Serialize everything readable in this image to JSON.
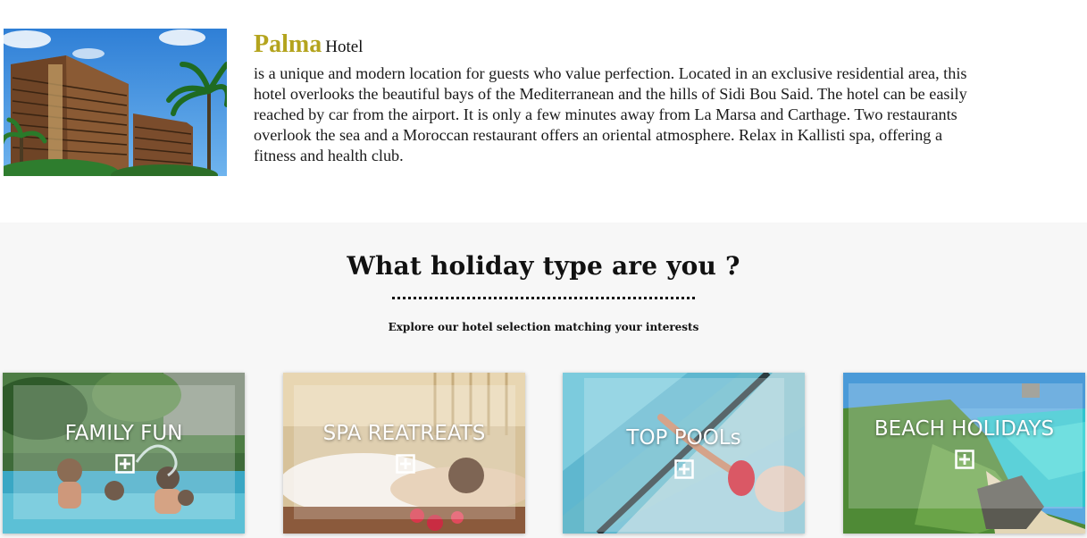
{
  "hotel": {
    "name": "Palma",
    "suffix": "Hotel",
    "description": "is a unique and modern location for guests who value perfection. Located in an exclusive residential area, this hotel overlooks the beautiful bays of the Mediterranean and the hills of Sidi Bou Said. The hotel can be easily reached by car from the airport. It is only a few minutes away from La Marsa and Carthage. Two restaurants overlook the sea and a Moroccan restaurant offers an oriental atmosphere. Relax in Kallisti spa, offering a fitness and health club."
  },
  "holiday": {
    "title": "What holiday type are you ?",
    "subtitle": "Explore our hotel selection matching your interests",
    "cards": [
      {
        "label": "FAMILY FUN",
        "icon": "plus-square-icon"
      },
      {
        "label": "SPA REATREATS",
        "icon": "plus-square-icon"
      },
      {
        "label": "TOP POOLs",
        "icon": "plus-square-icon"
      },
      {
        "label": "BEACH HOLIDAYS",
        "icon": "plus-square-icon"
      }
    ]
  },
  "colors": {
    "hotel_name": "#b4a41e",
    "section_background": "#f7f7f7",
    "card_label": "#ffffff"
  }
}
